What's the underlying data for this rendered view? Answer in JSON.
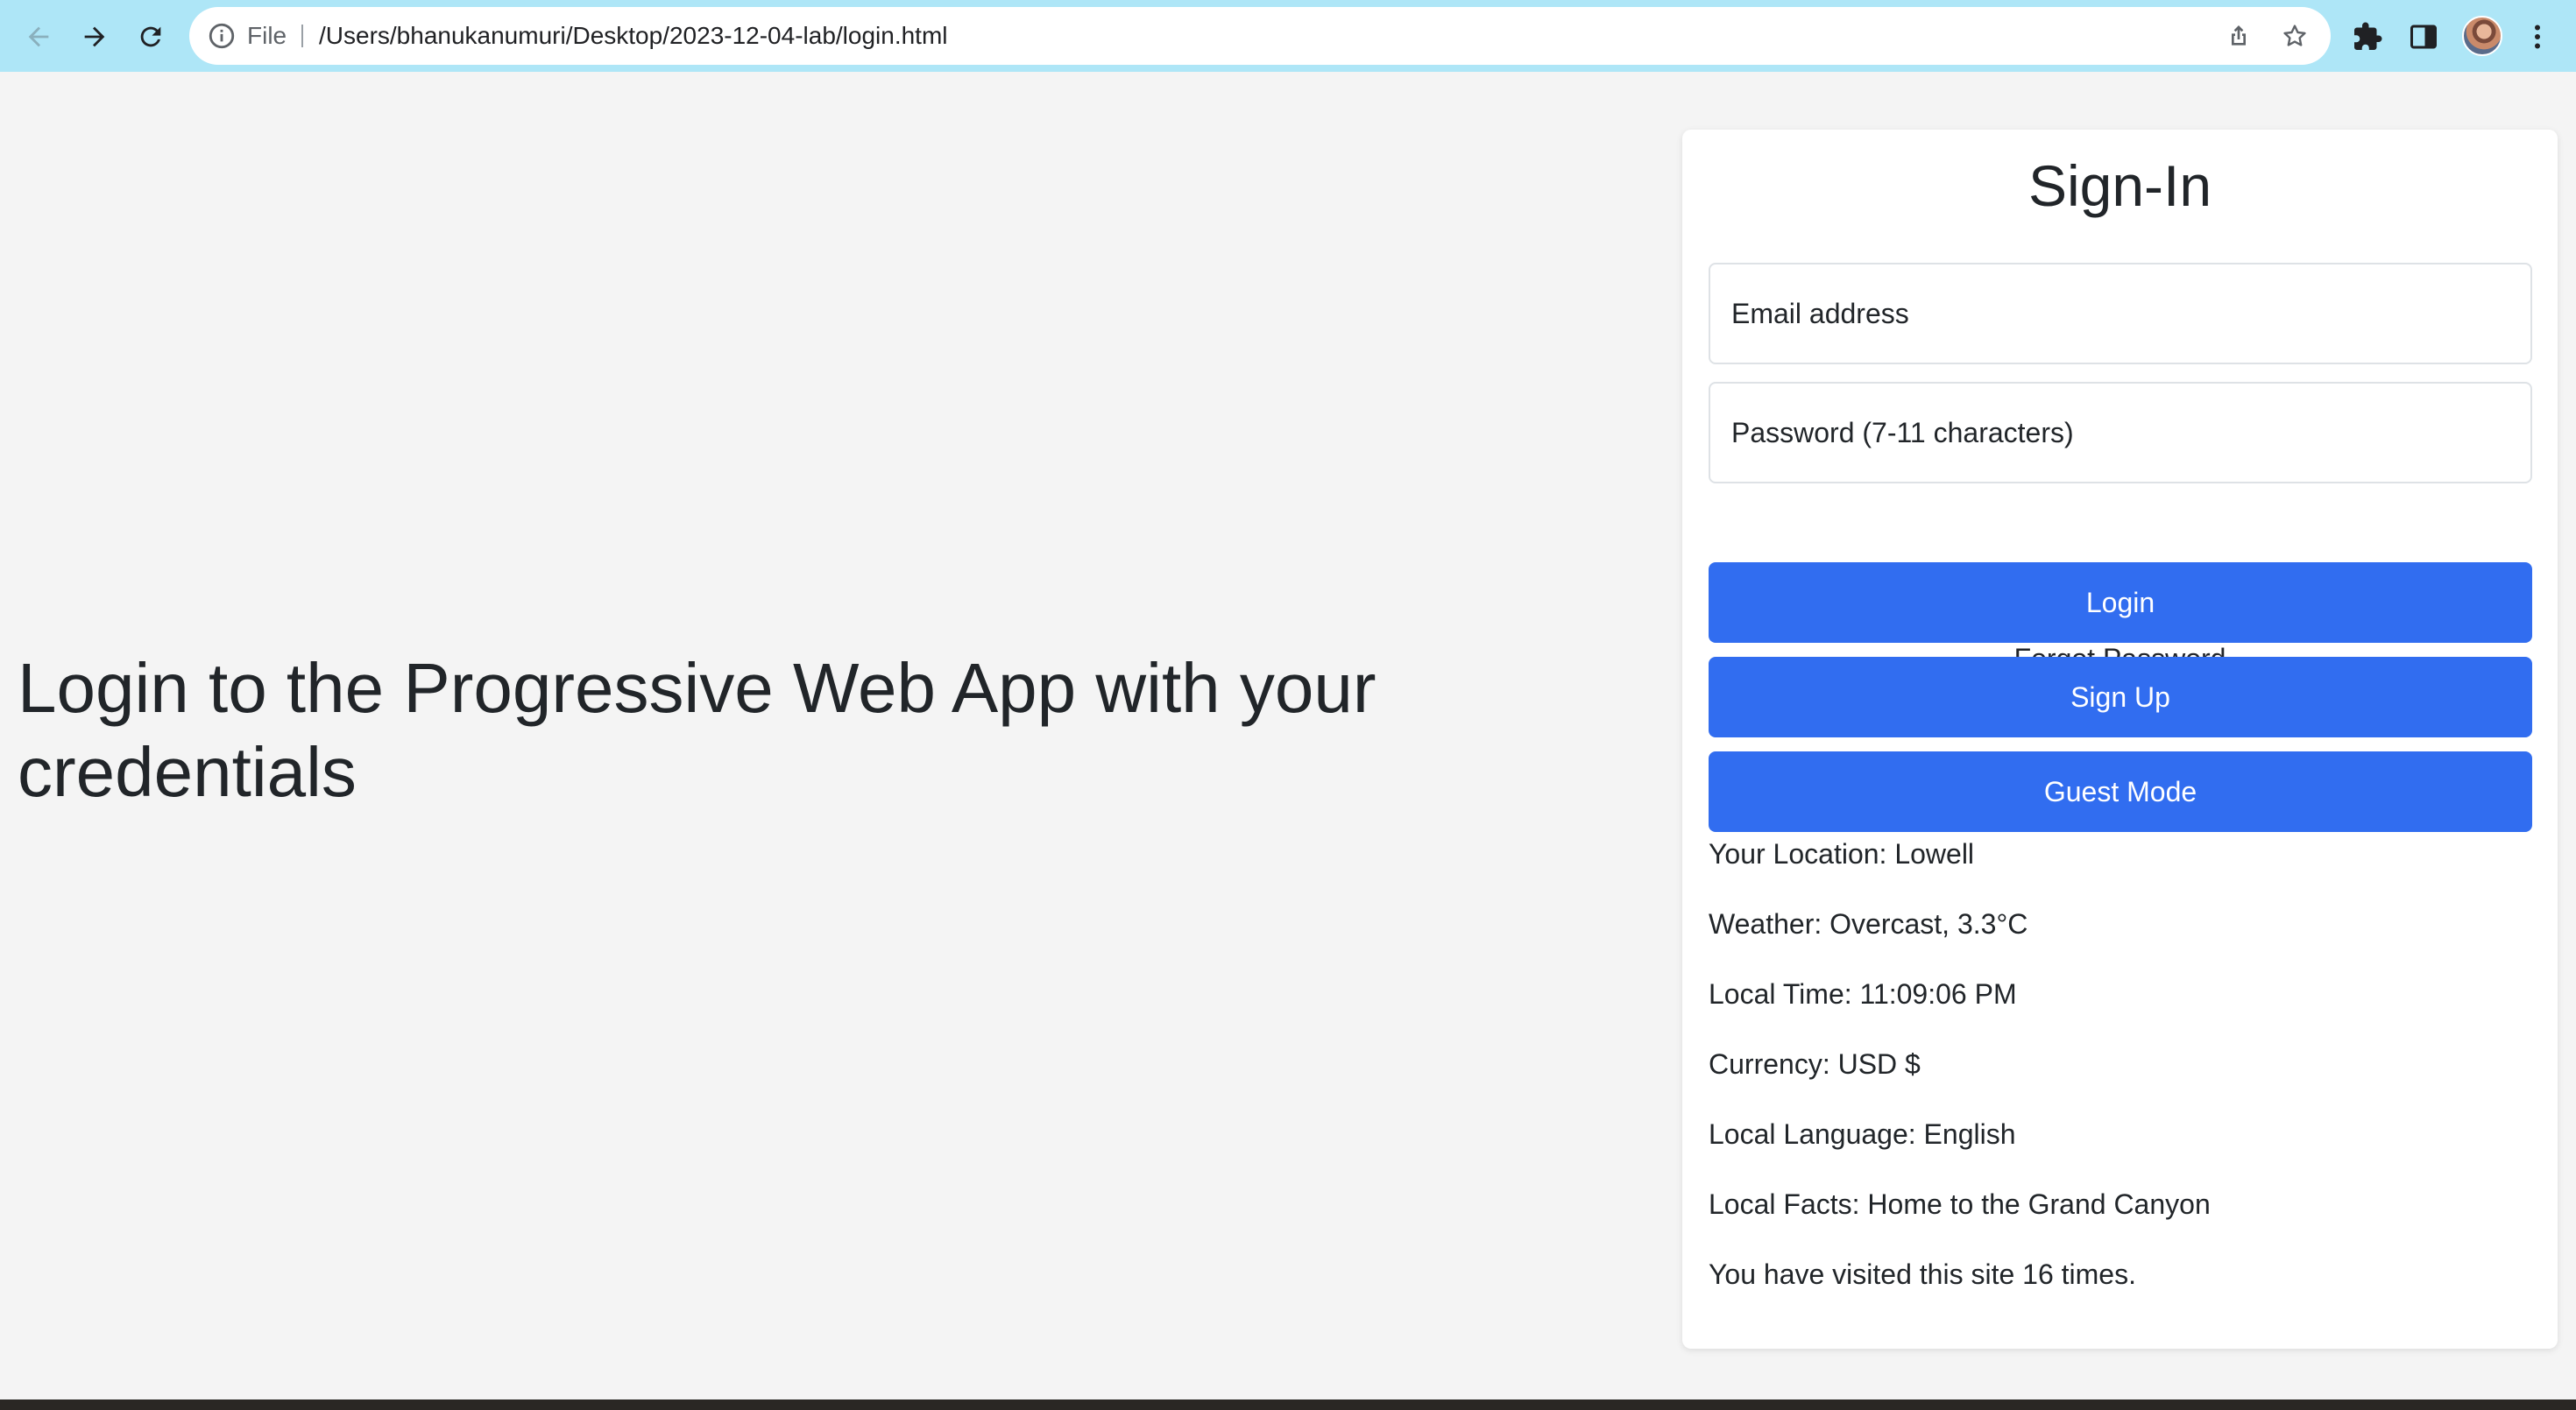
{
  "browser": {
    "scheme_label": "File",
    "url": "/Users/bhanukanumuri/Desktop/2023-12-04-lab/login.html",
    "icons": {
      "back": "arrow-left-icon",
      "forward": "arrow-right-icon",
      "reload": "reload-icon",
      "site_info": "info-icon",
      "share": "share-icon",
      "bookmark": "star-icon",
      "extensions": "puzzle-icon",
      "side_panel": "side-panel-icon",
      "menu": "kebab-menu-icon"
    },
    "toolbar_color": "#aee6f7"
  },
  "hero": {
    "text": "Login to the Progressive Web App with your credentials"
  },
  "signin": {
    "title": "Sign-In",
    "email_placeholder": "Email address",
    "password_placeholder": "Password (7-11 characters)",
    "forgot_label": "Forgot Password",
    "login_label": "Login",
    "signup_label": "Sign Up",
    "guest_label": "Guest Mode",
    "button_color": "#316df0"
  },
  "info": {
    "location": "Your Location: Lowell",
    "weather": "Weather: Overcast, 3.3°C",
    "time": "Local Time: 11:09:06 PM",
    "currency": "Currency: USD $",
    "language": "Local Language: English",
    "facts": "Local Facts: Home to the Grand Canyon",
    "visits": "You have visited this site 16 times."
  }
}
